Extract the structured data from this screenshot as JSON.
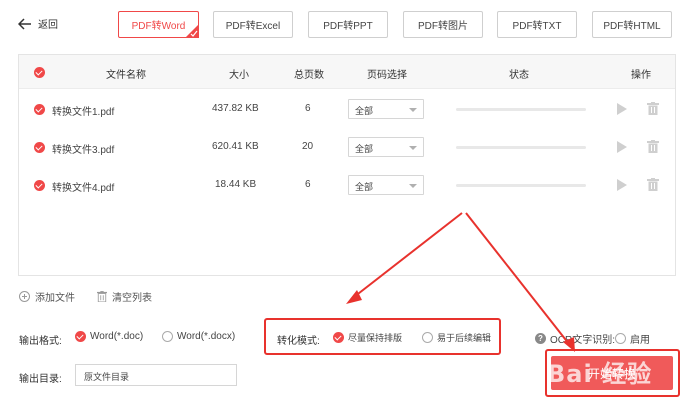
{
  "header": {
    "back_label": "返回",
    "tabs": [
      {
        "label": "PDF转Word",
        "active": true
      },
      {
        "label": "PDF转Excel",
        "active": false
      },
      {
        "label": "PDF转PPT",
        "active": false
      },
      {
        "label": "PDF转图片",
        "active": false
      },
      {
        "label": "PDF转TXT",
        "active": false
      },
      {
        "label": "PDF转HTML",
        "active": false
      }
    ]
  },
  "table": {
    "columns": {
      "name": "文件名称",
      "size": "大小",
      "pages": "总页数",
      "page_select": "页码选择",
      "status": "状态",
      "actions": "操作"
    },
    "rows": [
      {
        "name": "转换文件1.pdf",
        "size": "437.82 KB",
        "pages": "6",
        "page_select": "全部",
        "progress": 0
      },
      {
        "name": "转换文件3.pdf",
        "size": "620.41 KB",
        "pages": "20",
        "page_select": "全部",
        "progress": 0
      },
      {
        "name": "转换文件4.pdf",
        "size": "18.44 KB",
        "pages": "6",
        "page_select": "全部",
        "progress": 0
      }
    ]
  },
  "actions": {
    "add_file": "添加文件",
    "clear_list": "清空列表"
  },
  "settings": {
    "output_format_label": "输出格式:",
    "format_options": [
      {
        "label": "Word(*.doc)",
        "selected": true
      },
      {
        "label": "Word(*.docx)",
        "selected": false
      }
    ],
    "mode_label": "转化模式:",
    "mode_options": [
      {
        "label": "尽量保持排版",
        "selected": true
      },
      {
        "label": "易于后续编辑",
        "selected": false
      }
    ],
    "ocr_label": "OCR文字识别:",
    "ocr_option": "启用",
    "output_dir_label": "输出目录:",
    "output_dir_value": "原文件目录"
  },
  "start_button": "开始转换",
  "watermark": "Bai 经验",
  "colors": {
    "accent": "#f04848",
    "annotation_red": "#e8322d"
  }
}
